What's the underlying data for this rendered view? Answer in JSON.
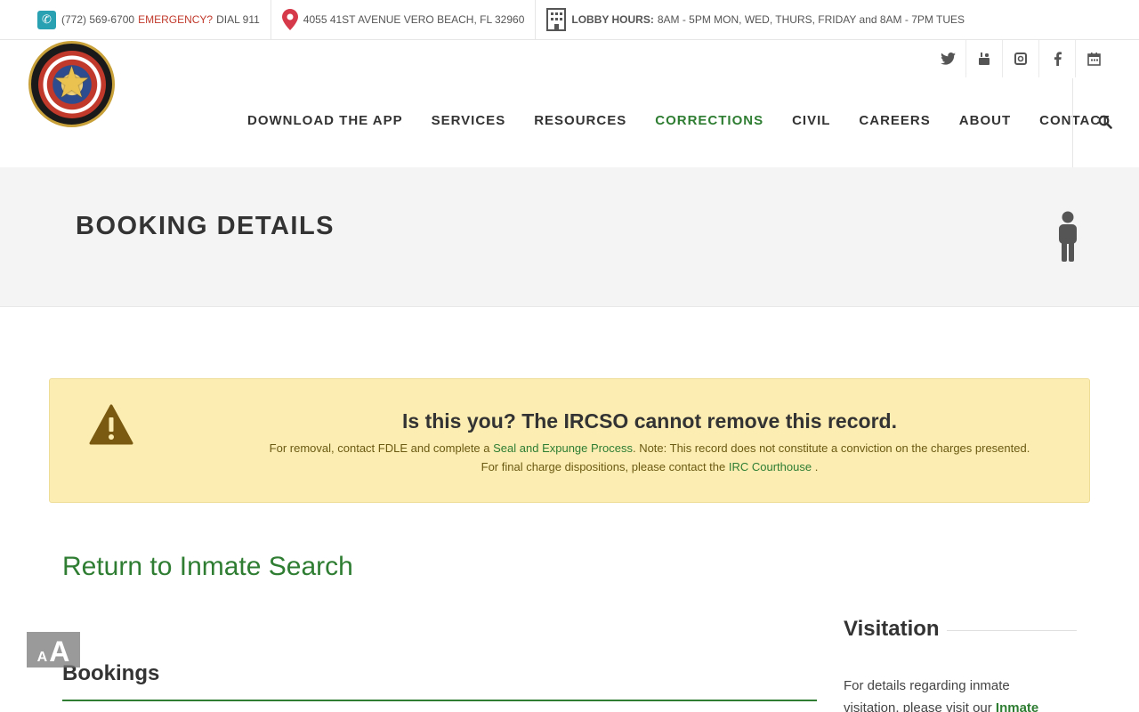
{
  "topbar": {
    "phone": "(772) 569-6700",
    "emergency_label": "EMERGENCY?",
    "emergency_value": "DIAL 911",
    "address": "4055 41ST AVENUE VERO BEACH, FL 32960",
    "hours_label": "LOBBY HOURS:",
    "hours_value": "8AM - 5PM MON, WED, THURS, FRIDAY and 8AM - 7PM TUES"
  },
  "logo": {
    "icon": "sheriff-badge-logo"
  },
  "social": [
    "twitter-icon",
    "youtube-icon",
    "instagram-icon",
    "facebook-icon",
    "calendar-icon"
  ],
  "nav": {
    "items": [
      {
        "label": "DOWNLOAD THE APP"
      },
      {
        "label": "SERVICES"
      },
      {
        "label": "RESOURCES"
      },
      {
        "label": "CORRECTIONS",
        "active": true
      },
      {
        "label": "CIVIL"
      },
      {
        "label": "CAREERS"
      },
      {
        "label": "ABOUT"
      },
      {
        "label": "CONTACT"
      }
    ]
  },
  "banner": {
    "title": "BOOKING DETAILS"
  },
  "alert": {
    "title": "Is this you? The IRCSO cannot remove this record.",
    "line1_prefix": "For removal, contact FDLE and complete a",
    "line1_link": "Seal and Expunge Process",
    "line1_suffix": ". Note: This record does not constitute a conviction on the charges presented.",
    "line2_prefix": "For final charge dispositions, please contact the",
    "line2_link": "IRC Courthouse",
    "line2_suffix": "."
  },
  "content": {
    "return_link": "Return to Inmate Search",
    "bookings_heading": "Bookings"
  },
  "sidebar": {
    "visitation_heading": "Visitation",
    "visitation_text": "For details regarding inmate visitation, please visit our",
    "visitation_link": "Inmate"
  },
  "colors": {
    "accent": "#2e7d32",
    "alert_bg": "#fcedb3",
    "emergency": "#c0392b",
    "warning_icon": "#7a5a10"
  }
}
